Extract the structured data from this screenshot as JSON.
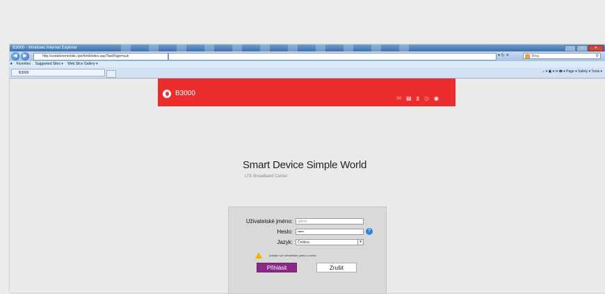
{
  "browser": {
    "title": "B3000 - Windows Internet Explorer",
    "address_url": "http://vodafonemobile.cpe/html/index.asp?lastPage=auk",
    "search_engine": "Bing",
    "favorites_label": "Favorites",
    "suggested_sites": "Suggested Sites ▾",
    "web_slice_gallery": "Web Slice Gallery ▾",
    "tab_label": "B3000",
    "command_bar": "Page ▾  Safety ▾  Tools ▾"
  },
  "router": {
    "brand": "B3000",
    "brand_color": "#ec2d2d",
    "slogan": "Smart Device   Simple World",
    "subtitle": "LTE Broadband Center"
  },
  "login": {
    "username_label": "Uživatelské jméno:",
    "username_value": "admin",
    "password_label": "Heslo:",
    "password_value": "•••••",
    "language_label": "Jazyk:",
    "language_value": "Čeština",
    "warning_text": "Zadejte své uživatelské jméno a heslo.",
    "login_button": "Přihlásit",
    "cancel_button": "Zrušit",
    "login_button_color": "#8a2a87"
  }
}
